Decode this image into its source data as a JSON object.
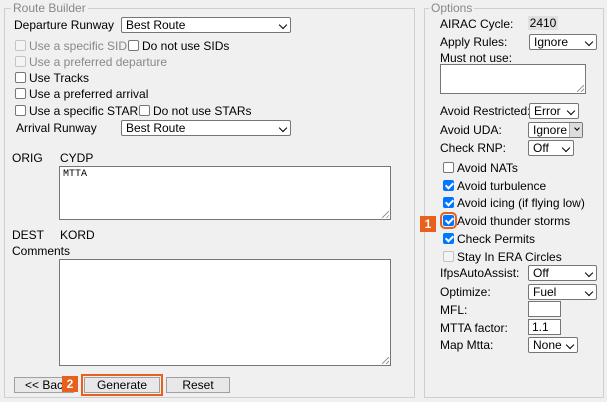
{
  "route_builder": {
    "legend": "Route Builder",
    "departure_runway_label": "Departure Runway",
    "departure_runway_value": "Best Route",
    "use_specific_sid": "Use a specific SID",
    "do_not_use_sids": "Do not use SIDs",
    "use_preferred_departure": "Use a preferred departure",
    "use_tracks": "Use Tracks",
    "use_preferred_arrival": "Use a preferred arrival",
    "use_specific_star": "Use a specific STAR",
    "do_not_use_stars": "Do not use STARs",
    "arrival_runway_label": "Arrival Runway",
    "arrival_runway_value": "Best Route",
    "orig_label": "ORIG",
    "orig_value": "CYDP",
    "route_text": "MTTA",
    "dest_label": "DEST",
    "dest_value": "KORD",
    "comments_label": "Comments",
    "comments_value": "",
    "back_button": "<< Bac",
    "generate_button": "Generate",
    "reset_button": "Reset"
  },
  "options": {
    "legend": "Options",
    "airac_label": "AIRAC Cycle:",
    "airac_value": "2410",
    "apply_rules_label": "Apply Rules:",
    "apply_rules_value": "Ignore",
    "must_not_use_label": "Must not use:",
    "must_not_use_value": "",
    "avoid_restricted_label": "Avoid Restricted:",
    "avoid_restricted_value": "Error",
    "avoid_uda_label": "Avoid UDA:",
    "avoid_uda_value": "Ignore",
    "check_rnp_label": "Check RNP:",
    "check_rnp_value": "Off",
    "avoid_nats": "Avoid NATs",
    "avoid_turbulence": "Avoid turbulence",
    "avoid_icing": "Avoid icing (if flying low)",
    "avoid_thunder": "Avoid thunder storms",
    "check_permits": "Check Permits",
    "stay_in_era": "Stay In ERA Circles",
    "ifps_label": "IfpsAutoAssist:",
    "ifps_value": "Off",
    "optimize_label": "Optimize:",
    "optimize_value": "Fuel",
    "mfl_label": "MFL:",
    "mfl_value": "",
    "mtta_factor_label": "MTTA factor:",
    "mtta_factor_value": "1.1",
    "map_mtta_label": "Map Mtta:",
    "map_mtta_value": "None"
  },
  "markers": {
    "one": "1",
    "two": "2"
  },
  "colors": {
    "marker": "#e8601c",
    "checkbox_checked": "#0075ff"
  }
}
